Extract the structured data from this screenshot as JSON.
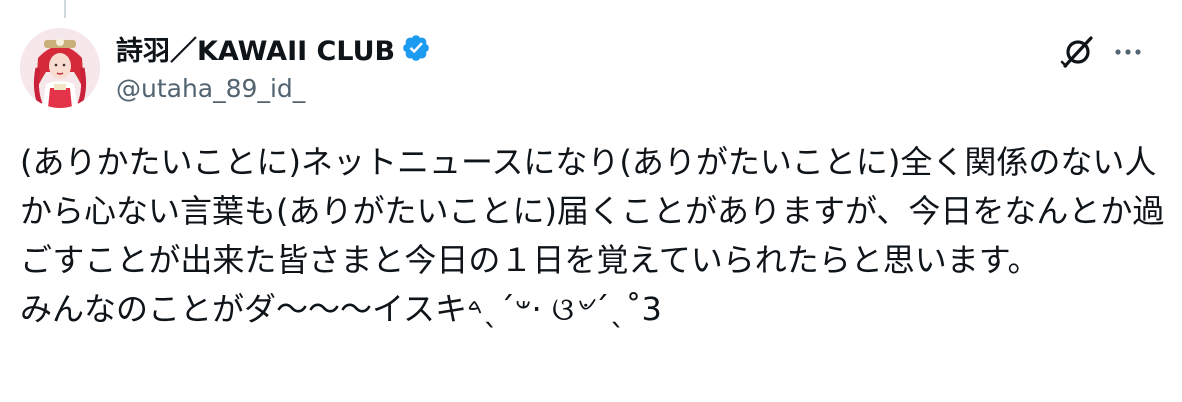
{
  "post": {
    "display_name": "詩羽／KAWAII CLUB",
    "handle": "@utaha_89_id_",
    "text": "(ありかたいことに)ネットニュースになり(ありがたいことに)全く関係のない人から心ない言葉も(ありがたいことに)届くことがありますが、今日をなんとか過ごすことが出来た皆さまと今日の１日を覚えていられたらと思います。\nみんなのことがダ〜〜〜イスキ𐤔ˊˎ𐤃⋅ ଓ৺ˊˎ˚3"
  },
  "icons": {
    "avatar": "profile-avatar",
    "verified": "verified-badge-icon",
    "grok": "grok-icon",
    "more": "more-options-icon"
  },
  "colors": {
    "verified": "#1d9bf0",
    "text": "#0f1419",
    "secondary": "#536471",
    "thread_line": "#cfd9de"
  }
}
